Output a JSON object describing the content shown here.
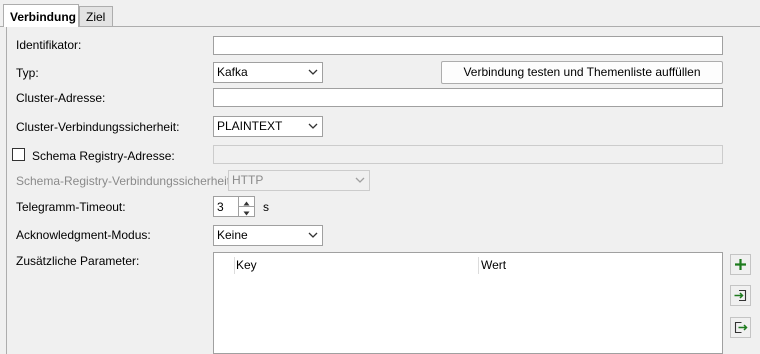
{
  "tabs": [
    {
      "label": "Verbindung",
      "active": true
    },
    {
      "label": "Ziel",
      "active": false
    }
  ],
  "form": {
    "identifikator": {
      "label": "Identifikator:",
      "value": ""
    },
    "typ": {
      "label": "Typ:",
      "value": "Kafka"
    },
    "test_button": {
      "label": "Verbindung testen und Themenliste auffüllen"
    },
    "cluster_adresse": {
      "label": "Cluster-Adresse:",
      "value": ""
    },
    "cluster_sicherheit": {
      "label": "Cluster-Verbindungssicherheit:",
      "value": "PLAINTEXT"
    },
    "schema_registry": {
      "label": "Schema Registry-Adresse:",
      "checked": false,
      "value": ""
    },
    "schema_sicherheit": {
      "label": "Schema-Registry-Verbindungssicherheit:",
      "value": "HTTP",
      "disabled": true
    },
    "timeout": {
      "label": "Telegramm-Timeout:",
      "value": "3",
      "unit": "s"
    },
    "ack_modus": {
      "label": "Acknowledgment-Modus:",
      "value": "Keine"
    },
    "params": {
      "label": "Zusätzliche Parameter:",
      "columns": [
        "Key",
        "Wert"
      ],
      "rows": []
    }
  },
  "icons": {
    "add": "plus-icon",
    "import": "import-icon",
    "export": "export-icon"
  },
  "colors": {
    "add_icon": "#1e7b1e",
    "arrow_icon": "#1e7b1e"
  }
}
